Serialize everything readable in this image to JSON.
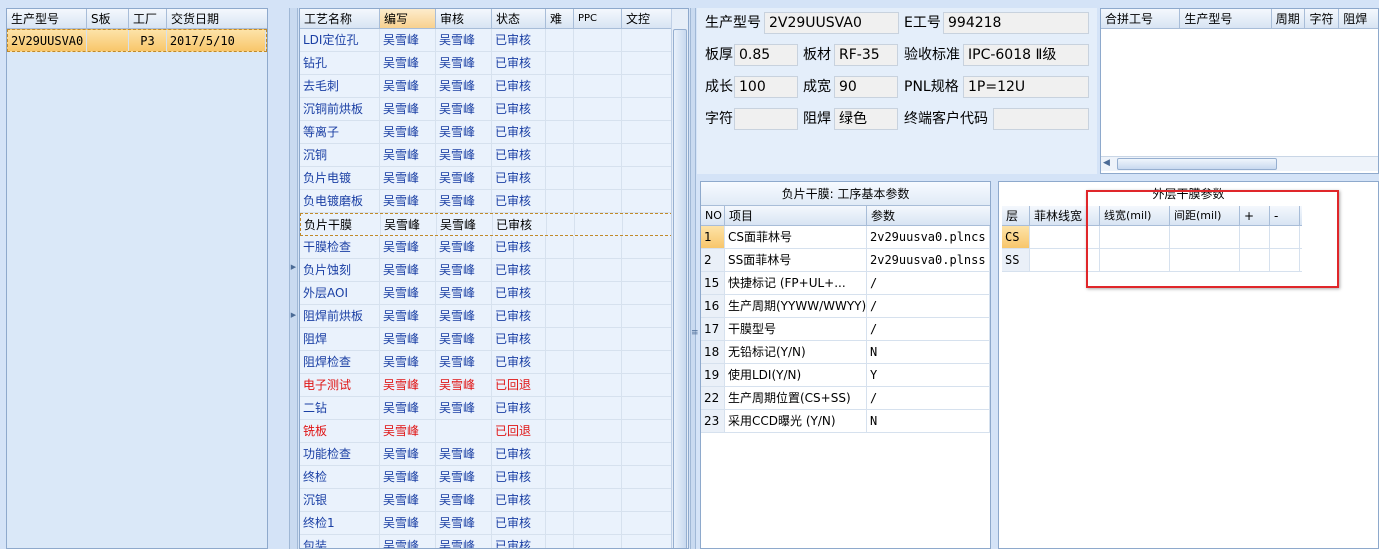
{
  "panel1": {
    "columns": [
      "生产型号",
      "S板",
      "工厂",
      "交货日期"
    ],
    "rows": [
      {
        "model": "2V29UUSVA0",
        "s_board": "",
        "factory": "P3",
        "delivery_date": "2017/5/10"
      }
    ]
  },
  "panel2": {
    "columns": [
      "工艺名称",
      "编写",
      "审核",
      "状态",
      "难",
      "PPC",
      "文控"
    ],
    "rows": [
      {
        "name": "LDI定位孔",
        "writer": "吴雪峰",
        "reviewer": "吴雪峰",
        "status": "已审核",
        "color": "blue"
      },
      {
        "name": "钻孔",
        "writer": "吴雪峰",
        "reviewer": "吴雪峰",
        "status": "已审核",
        "color": "blue"
      },
      {
        "name": "去毛刺",
        "writer": "吴雪峰",
        "reviewer": "吴雪峰",
        "status": "已审核",
        "color": "blue"
      },
      {
        "name": "沉铜前烘板",
        "writer": "吴雪峰",
        "reviewer": "吴雪峰",
        "status": "已审核",
        "color": "blue"
      },
      {
        "name": "等离子",
        "writer": "吴雪峰",
        "reviewer": "吴雪峰",
        "status": "已审核",
        "color": "blue"
      },
      {
        "name": "沉铜",
        "writer": "吴雪峰",
        "reviewer": "吴雪峰",
        "status": "已审核",
        "color": "blue"
      },
      {
        "name": "负片电镀",
        "writer": "吴雪峰",
        "reviewer": "吴雪峰",
        "status": "已审核",
        "color": "blue"
      },
      {
        "name": "负电镀磨板",
        "writer": "吴雪峰",
        "reviewer": "吴雪峰",
        "status": "已审核",
        "color": "blue"
      },
      {
        "name": "负片干膜",
        "writer": "吴雪峰",
        "reviewer": "吴雪峰",
        "status": "已审核",
        "color": "selected"
      },
      {
        "name": "干膜检查",
        "writer": "吴雪峰",
        "reviewer": "吴雪峰",
        "status": "已审核",
        "color": "blue"
      },
      {
        "name": "负片蚀刻",
        "writer": "吴雪峰",
        "reviewer": "吴雪峰",
        "status": "已审核",
        "color": "blue"
      },
      {
        "name": "外层AOI",
        "writer": "吴雪峰",
        "reviewer": "吴雪峰",
        "status": "已审核",
        "color": "blue"
      },
      {
        "name": "阻焊前烘板",
        "writer": "吴雪峰",
        "reviewer": "吴雪峰",
        "status": "已审核",
        "color": "blue"
      },
      {
        "name": "阻焊",
        "writer": "吴雪峰",
        "reviewer": "吴雪峰",
        "status": "已审核",
        "color": "blue"
      },
      {
        "name": "阻焊检查",
        "writer": "吴雪峰",
        "reviewer": "吴雪峰",
        "status": "已审核",
        "color": "blue"
      },
      {
        "name": "电子测试",
        "writer": "吴雪峰",
        "reviewer": "吴雪峰",
        "status": "已回退",
        "color": "red"
      },
      {
        "name": "二钻",
        "writer": "吴雪峰",
        "reviewer": "吴雪峰",
        "status": "已审核",
        "color": "blue"
      },
      {
        "name": "铣板",
        "writer": "吴雪峰",
        "reviewer": "",
        "status": "已回退",
        "color": "red"
      },
      {
        "name": "功能检查",
        "writer": "吴雪峰",
        "reviewer": "吴雪峰",
        "status": "已审核",
        "color": "blue"
      },
      {
        "name": "终检",
        "writer": "吴雪峰",
        "reviewer": "吴雪峰",
        "status": "已审核",
        "color": "blue"
      },
      {
        "name": "沉银",
        "writer": "吴雪峰",
        "reviewer": "吴雪峰",
        "status": "已审核",
        "color": "blue"
      },
      {
        "name": "终检1",
        "writer": "吴雪峰",
        "reviewer": "吴雪峰",
        "status": "已审核",
        "color": "blue"
      },
      {
        "name": "包装",
        "writer": "吴雪峰",
        "reviewer": "吴雪峰",
        "status": "已审核",
        "color": "blue"
      }
    ]
  },
  "info": {
    "model_label": "生产型号",
    "model_value": "2V29UUSVA0",
    "eno_label": "E工号",
    "eno_value": "994218",
    "thickness_label": "板厚",
    "thickness_value": "0.85",
    "material_label": "板材",
    "material_value": "RF-35",
    "standard_label": "验收标准",
    "standard_value": "IPC-6018 Ⅱ级",
    "length_label": "成长",
    "length_value": "100",
    "width_label": "成宽",
    "width_value": "90",
    "pnl_label": "PNL规格",
    "pnl_value": "1P=12U",
    "char_label": "字符",
    "char_value": "",
    "solder_label": "阻焊",
    "solder_value": "绿色",
    "client_label": "终端客户代码",
    "client_value": ""
  },
  "grid2": {
    "columns": [
      "合拼工号",
      "生产型号",
      "周期",
      "字符",
      "阻焊"
    ]
  },
  "panel3": {
    "title": "负片干膜: 工序基本参数",
    "columns": [
      "NO",
      "项目",
      "参数"
    ],
    "rows": [
      {
        "no": "1",
        "item": "CS面菲林号",
        "param": "2v29uusva0.plncs"
      },
      {
        "no": "2",
        "item": "SS面菲林号",
        "param": "2v29uusva0.plnss"
      },
      {
        "no": "15",
        "item": "快捷标记 (FP+UL+...",
        "param": "/"
      },
      {
        "no": "16",
        "item": "生产周期(YYWW/WWYY)",
        "param": "/"
      },
      {
        "no": "17",
        "item": "干膜型号",
        "param": "/"
      },
      {
        "no": "18",
        "item": "无铅标记(Y/N)",
        "param": "N"
      },
      {
        "no": "19",
        "item": "使用LDI(Y/N)",
        "param": "Y"
      },
      {
        "no": "22",
        "item": "生产周期位置(CS+SS)",
        "param": "/"
      },
      {
        "no": "23",
        "item": "采用CCD曝光 (Y/N)",
        "param": "N"
      }
    ]
  },
  "panel4": {
    "title": "外层干膜参数",
    "columns": [
      "层",
      "菲林线宽",
      "线宽(mil)",
      "间距(mil)",
      "+",
      "-"
    ],
    "rows": [
      {
        "layer": "CS"
      },
      {
        "layer": "SS"
      }
    ]
  }
}
